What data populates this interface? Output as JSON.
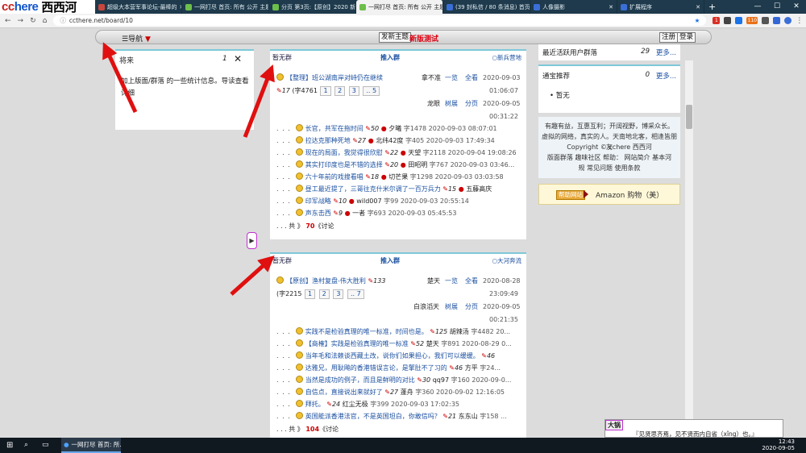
{
  "browser": {
    "logo": {
      "part1": "cc",
      "part2": "here",
      "part3": "西西河"
    },
    "tabs": [
      {
        "label": "超级大本营军事论坛-最棒的",
        "active": false,
        "color": "#c9463d"
      },
      {
        "label": "一网打尽 首页: 所有 公开 主题",
        "active": false,
        "color": "#6cbf4a"
      },
      {
        "label": "分页 第3页:【原创】2020 新",
        "active": false,
        "color": "#6cbf4a"
      },
      {
        "label": "一网打尽 首页: 所有 公开 主题",
        "active": true,
        "color": "#6cbf4a"
      },
      {
        "label": "(39 封私信 / 80 条消息) 首页",
        "active": false,
        "color": "#3a6fd8"
      },
      {
        "label": "人像摄影",
        "active": false,
        "color": "#3a6fd8"
      },
      {
        "label": "扩展程序",
        "active": false,
        "color": "#3a6fd8"
      }
    ],
    "url": "ccthere.net/board/10",
    "ext_badges": [
      "1",
      "110"
    ]
  },
  "topbar": {
    "nav": "☰导航",
    "nav_arrow": "▼",
    "new_topic": "发新主题",
    "new_version": "新版测试",
    "register": "注册",
    "login": "登录"
  },
  "stats_panel": {
    "title": "将来",
    "count": "1",
    "close": "✕",
    "description": "加上版面/群落 的一些统计信息。导读查看详细"
  },
  "forums": [
    {
      "label_left": "暂无群",
      "label_mid": "推入群",
      "label_right": "新兵营地",
      "main": {
        "title": "【整理】班公湖南岸对峙仍在继续",
        "stars": "17",
        "word_count": "(字4761",
        "pages": [
          "1",
          "2",
          "3",
          ".. 5"
        ],
        "author": "拿不准",
        "link_all": "一览",
        "link_full": "全看",
        "date": "2020-09-03",
        "time": "01:06:07",
        "last_author": "龙眼",
        "tree": "树展",
        "page_view": "分页",
        "last_date": "2020-09-05",
        "last_time": "00:31:22"
      },
      "replies": [
        {
          "title": "长官，共军在拖时间",
          "stars": "50",
          "author": "夕曦",
          "meta": "字1478 2020-09-03 08:07:01"
        },
        {
          "title": "拉达克那种死地",
          "stars": "27",
          "author": "北纬42度",
          "meta": "字405 2020-09-03 17:49:34"
        },
        {
          "title": "现在的局面，我觉得很欣慰",
          "stars": "22",
          "author": "天望",
          "meta": "字2118 2020-09-04 19:08:26"
        },
        {
          "title": "其实打印度也是不错的选择",
          "stars": "20",
          "author": "田昭明",
          "meta": "字767 2020-09-03 03:46..."
        },
        {
          "title": "六十年前的戏搜看唱",
          "stars": "18",
          "author": "切芒果",
          "meta": "字1298 2020-09-03 03:03:58"
        },
        {
          "title": "昼工最近提了，三哥往克什米尔调了一百万兵力",
          "stars": "15",
          "author": "五藤高庆",
          "meta": ""
        },
        {
          "title": "印军战略",
          "stars": "10",
          "author": "wild007",
          "meta": "字99 2020-09-03 20:55:14"
        },
        {
          "title": "声东击西",
          "stars": "9",
          "author": "一者",
          "meta": "字693 2020-09-03 05:45:53"
        }
      ],
      "total_prefix": ". . . 共 》",
      "total": "70",
      "total_suffix": "《讨论"
    },
    {
      "label_left": "暂无群",
      "label_mid": "推入群",
      "label_right": "大河奔流",
      "main": {
        "title": "【原创】渔村复盘-伟大胜利",
        "stars": "133",
        "word_count": "(字2215",
        "pages": [
          "1",
          "2",
          "3",
          ".. 7"
        ],
        "author": "楚天",
        "link_all": "一览",
        "link_full": "全看",
        "date": "2020-08-28",
        "time": "23:09:49",
        "last_author": "白浪滔天",
        "tree": "树展",
        "page_view": "分页",
        "last_date": "2020-09-05",
        "last_time": "00:21:35"
      },
      "replies": [
        {
          "title": "实践不是检验真理的唯一标准，时间也是。",
          "stars": "125",
          "author": "胡辣汤",
          "meta": "字4482 20..."
        },
        {
          "title": "【商榷】实践是检验真理的唯一标准",
          "stars": "52",
          "author": "楚天",
          "meta": "字891 2020-08-29 0..."
        },
        {
          "title": "当年毛和法赖谈西藏土改，说你们如果担心，我们可以缓缓。",
          "stars": "46",
          "author": "",
          "meta": ""
        },
        {
          "title": "达雅兄，用耿飚的香港错误言论，是擎肚不了习的",
          "stars": "46",
          "author": "方平",
          "meta": "字24..."
        },
        {
          "title": "当然是成功的例子，而且是鲜明的对比",
          "stars": "30",
          "author": "qq97",
          "meta": "字160 2020-09-0..."
        },
        {
          "title": "自信点，直接说出来就好了",
          "stars": "27",
          "author": "蓬舟",
          "meta": "字360 2020-09-02 12:16:05"
        },
        {
          "title": "拜托。",
          "stars": "24",
          "author": "红尘无极",
          "meta": "字399 2020-09-03 17:02:35"
        },
        {
          "title": "英国能派香港法官，不是英国坦白，你敢信吗？",
          "stars": "21",
          "author": "东东山",
          "meta": "字158 ..."
        }
      ],
      "total_prefix": ". . . 共 》",
      "total": "104",
      "total_suffix": "《讨论"
    }
  ],
  "sidebar": {
    "recent": {
      "label": "最近活跃用户群落",
      "count": "29",
      "more": "更多..."
    },
    "recommend": {
      "label": "通宝推荐",
      "count": "0",
      "more": "更多..."
    },
    "none": "暂无",
    "about": {
      "line1": "有趣有益，互惠互利；开阔视野，博采众长。",
      "line2": "虚拟的网络，真实的人。天南地北客，相逢皆朋友",
      "copyright": "Copyright © cchere 西西河",
      "links1": "版面群落  趣味社区  帮助：  网站简介  基本河",
      "links2": "规  常见问题  使用条款"
    },
    "amazon": {
      "badge": "帮助网站",
      "label": "Amazon 购物（美）"
    }
  },
  "toggle": "▶",
  "popup": {
    "title": "大锅",
    "text": "『见贤思齐焉，见不贤而内自省（xǐng）也。』"
  },
  "taskbar": {
    "item": "一网打尽 首页: 所...",
    "time": "12:43",
    "date": "2020-09-05"
  }
}
